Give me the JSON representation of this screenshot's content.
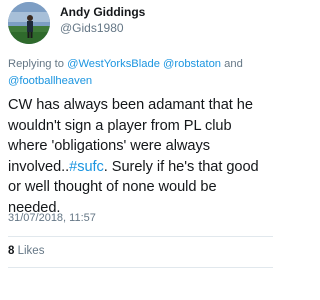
{
  "author": {
    "display_name": "Andy Giddings",
    "handle": "@Gids1980",
    "avatar": "profile-photo-football-pitch"
  },
  "reply": {
    "prefix": "Replying to",
    "mentions": [
      "@WestYorksBlade",
      "@robstaton",
      "@footballheaven"
    ],
    "conjunction": "and"
  },
  "tweet": {
    "text_before_hashtag": "CW has always been adamant that he wouldn't sign a player from PL club where 'obligations' were always involved..",
    "hashtag": "#sufc",
    "text_after_hashtag": ". Surely if he's that good or well thought of none would be needed.",
    "timestamp": "31/07/2018, 11:57"
  },
  "engagement": {
    "likes_count": "8",
    "likes_label": "Likes"
  },
  "colors": {
    "link": "#1b95e0",
    "muted": "#657786",
    "text": "#14171a",
    "divider": "#e1e8ed"
  }
}
